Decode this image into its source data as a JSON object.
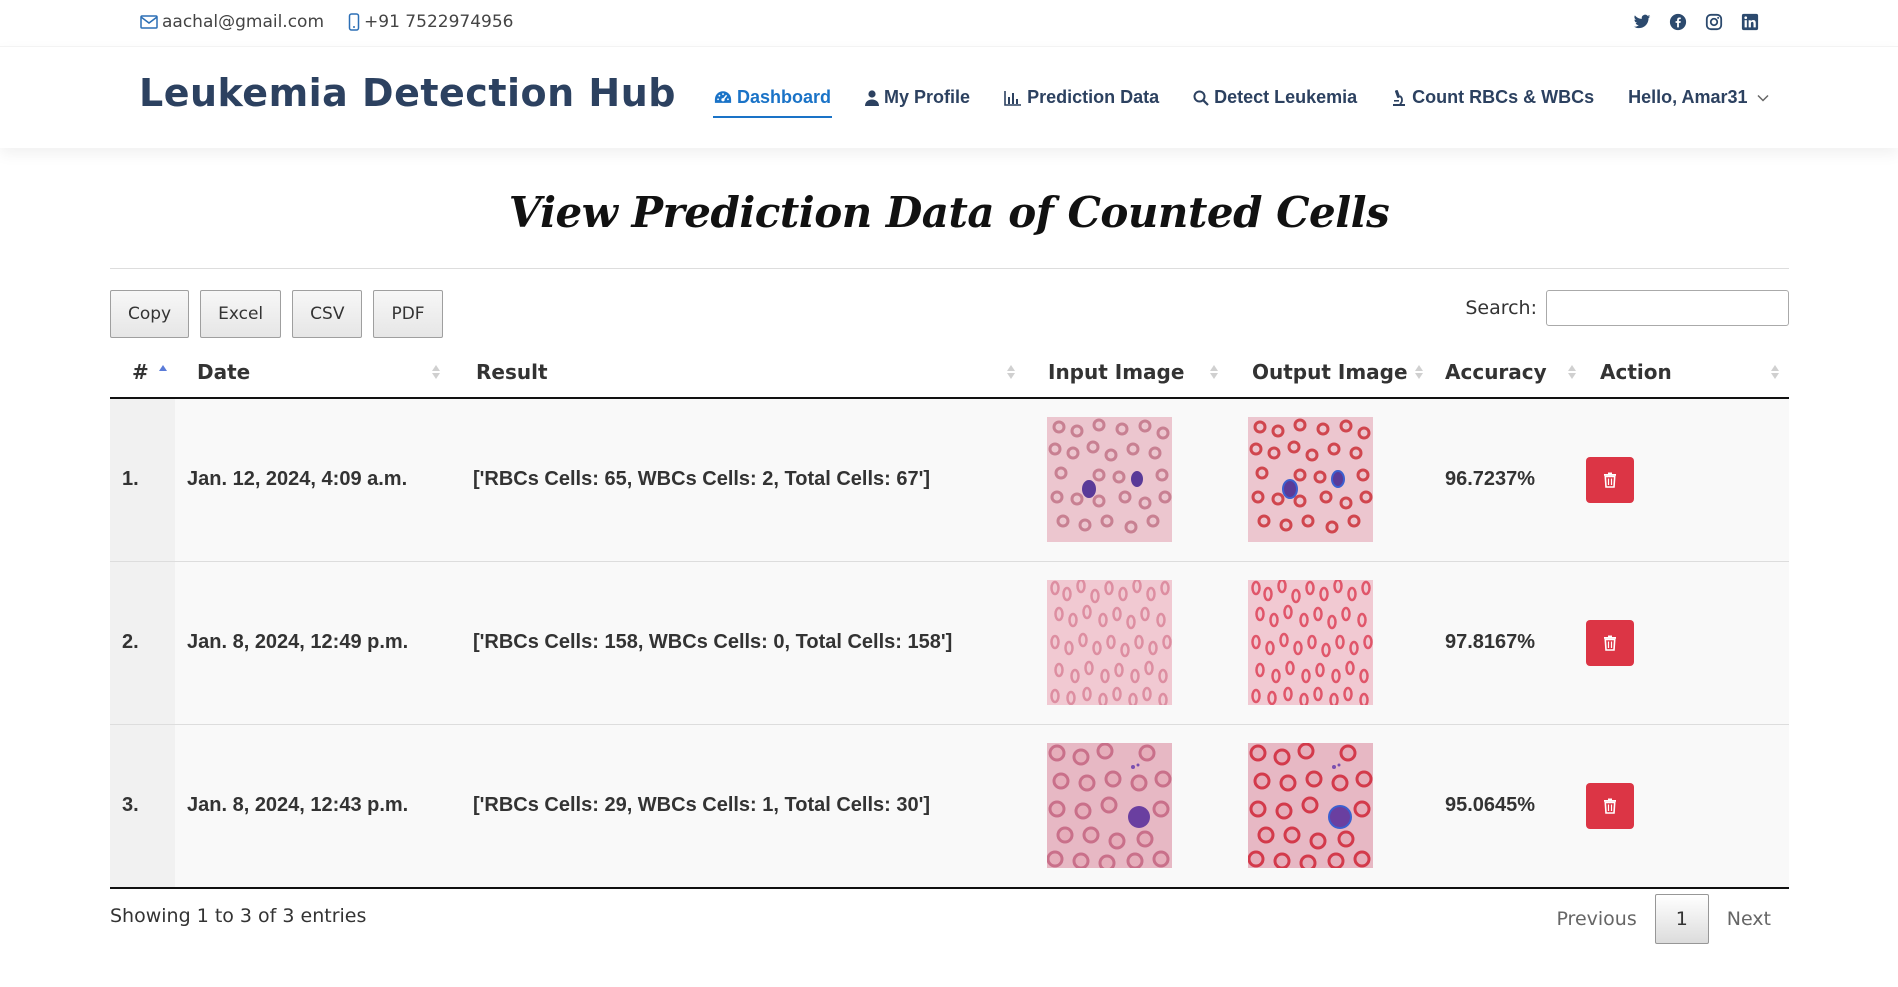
{
  "topbar": {
    "email": "aachal@gmail.com",
    "phone": "+91 7522974956",
    "social": [
      "twitter-icon",
      "facebook-icon",
      "instagram-icon",
      "linkedin-icon"
    ]
  },
  "header": {
    "brand": "Leukemia Detection Hub",
    "nav": [
      {
        "label": "Dashboard",
        "icon": "dashboard-icon",
        "active": true
      },
      {
        "label": "My Profile",
        "icon": "user-icon"
      },
      {
        "label": "Prediction Data",
        "icon": "bar-chart-icon"
      },
      {
        "label": "Detect Leukemia",
        "icon": "search-icon"
      },
      {
        "label": "Count RBCs & WBCs",
        "icon": "microscope-icon"
      }
    ],
    "user_greeting": "Hello, Amar31"
  },
  "page_title": "View Prediction Data of Counted Cells",
  "toolbar": {
    "buttons": [
      "Copy",
      "Excel",
      "CSV",
      "PDF"
    ],
    "search_label": "Search:"
  },
  "table": {
    "columns": [
      "#",
      "Date",
      "Result",
      "Input Image",
      "Output Image",
      "Accuracy",
      "Action"
    ],
    "rows": [
      {
        "num": "1.",
        "date": "Jan. 12, 2024, 4:09 a.m.",
        "result": "['RBCs Cells: 65, WBCs Cells: 2, Total Cells: 67']",
        "accuracy": "96.7237%"
      },
      {
        "num": "2.",
        "date": "Jan. 8, 2024, 12:49 p.m.",
        "result": "['RBCs Cells: 158, WBCs Cells: 0, Total Cells: 158']",
        "accuracy": "97.8167%"
      },
      {
        "num": "3.",
        "date": "Jan. 8, 2024, 12:43 p.m.",
        "result": "['RBCs Cells: 29, WBCs Cells: 1, Total Cells: 30']",
        "accuracy": "95.0645%"
      }
    ]
  },
  "footer": {
    "info": "Showing 1 to 3 of 3 entries",
    "previous": "Previous",
    "page": "1",
    "next": "Next"
  },
  "colors": {
    "brand": "#2c4160",
    "active_nav": "#1a73c7",
    "delete": "#dc3545"
  }
}
